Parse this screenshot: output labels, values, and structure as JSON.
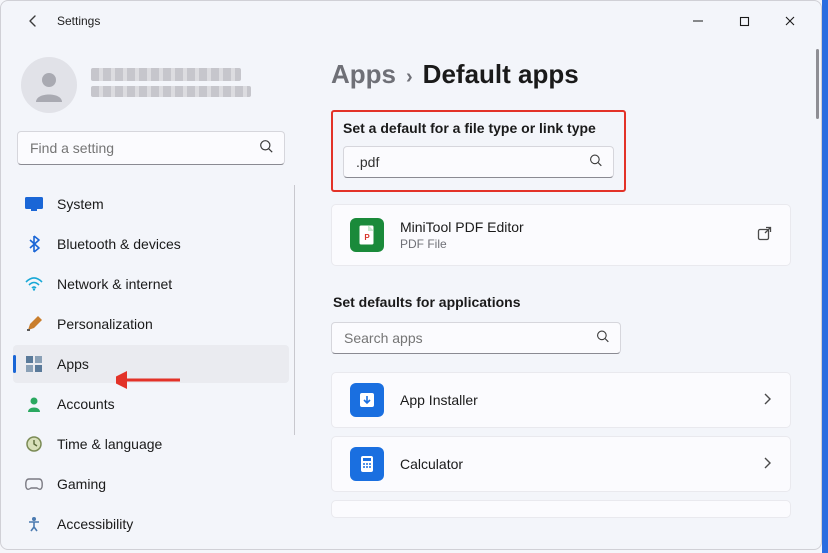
{
  "window": {
    "title": "Settings"
  },
  "sidebar": {
    "search_placeholder": "Find a setting",
    "items": [
      {
        "label": "System"
      },
      {
        "label": "Bluetooth & devices"
      },
      {
        "label": "Network & internet"
      },
      {
        "label": "Personalization"
      },
      {
        "label": "Apps"
      },
      {
        "label": "Accounts"
      },
      {
        "label": "Time & language"
      },
      {
        "label": "Gaming"
      },
      {
        "label": "Accessibility"
      }
    ],
    "selected_index": 4
  },
  "breadcrumb": {
    "parent": "Apps",
    "current": "Default apps"
  },
  "filetype_section": {
    "title": "Set a default for a file type or link type",
    "input_value": ".pdf"
  },
  "filetype_result": {
    "app_name": "MiniTool PDF Editor",
    "subtitle": "PDF File"
  },
  "app_section": {
    "title": "Set defaults for applications",
    "search_placeholder": "Search apps",
    "apps": [
      {
        "name": "App Installer"
      },
      {
        "name": "Calculator"
      }
    ]
  },
  "colors": {
    "accent": "#1a66d6",
    "highlight_border": "#e33228"
  }
}
